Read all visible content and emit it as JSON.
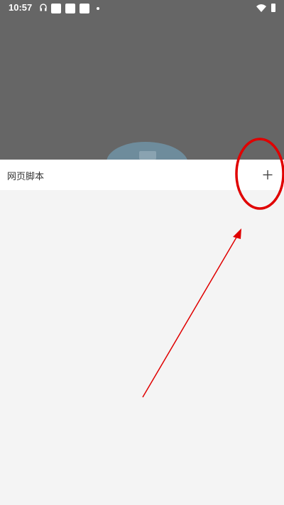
{
  "status_bar": {
    "time": "10:57",
    "icons": [
      "headset-icon",
      "notification-square-icon",
      "notification-square-icon",
      "notification-square-icon",
      "dot-icon",
      "wifi-icon",
      "battery-icon"
    ]
  },
  "header": {
    "title": "网页脚本",
    "add_icon": "plus-icon"
  },
  "colors": {
    "overlay": "#666666",
    "background": "#f4f4f4",
    "header_bg": "#ffffff",
    "annotation": "#e00000"
  }
}
